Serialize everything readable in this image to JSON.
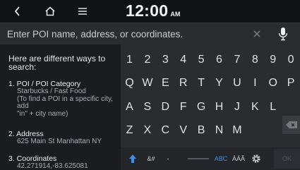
{
  "clock": {
    "time": "12:00",
    "ampm": "AM"
  },
  "search": {
    "placeholder": "Enter POI name, address, or coordinates."
  },
  "help": {
    "intro": "Here are different ways to search:",
    "items": [
      {
        "title": "1. POI / POI Category",
        "lines": [
          "Starbucks / Fast Food",
          "(To find a POI in a specific city, add",
          "\"in\" + city name)"
        ]
      },
      {
        "title": "2. Address",
        "lines": [
          "625 Main St Manhattan NY"
        ]
      },
      {
        "title": "3. Coordinates",
        "lines": [
          "42.271914,-83.625081"
        ]
      }
    ]
  },
  "keyboard": {
    "row1": [
      "1",
      "2",
      "3",
      "4",
      "5",
      "6",
      "7",
      "8",
      "9",
      "0"
    ],
    "row2": [
      "Q",
      "W",
      "E",
      "R",
      "T",
      "Y",
      "U",
      "I",
      "O",
      "P"
    ],
    "row3": [
      "A",
      "S",
      "D",
      "F",
      "G",
      "H",
      "J",
      "K",
      "L"
    ],
    "row4": [
      "Z",
      "X",
      "C",
      "V",
      "B",
      "N",
      "M"
    ],
    "symbols_label": "&#",
    "dash_label": "-",
    "abc_label": "ABC",
    "accent_label": "ÀÁÂ",
    "ok_label": "OK"
  },
  "colors": {
    "accent": "#3d8fe6",
    "background": "#000000",
    "keyboard": "#2a2c30",
    "panel": "#1a1c1f"
  },
  "icons": {
    "back": "chevron-left-icon",
    "home": "home-icon",
    "menu": "menu-icon",
    "mic": "microphone-icon",
    "clear": "close-icon",
    "shift": "shift-arrow-icon",
    "settings": "gear-icon",
    "backspace": "backspace-icon"
  }
}
